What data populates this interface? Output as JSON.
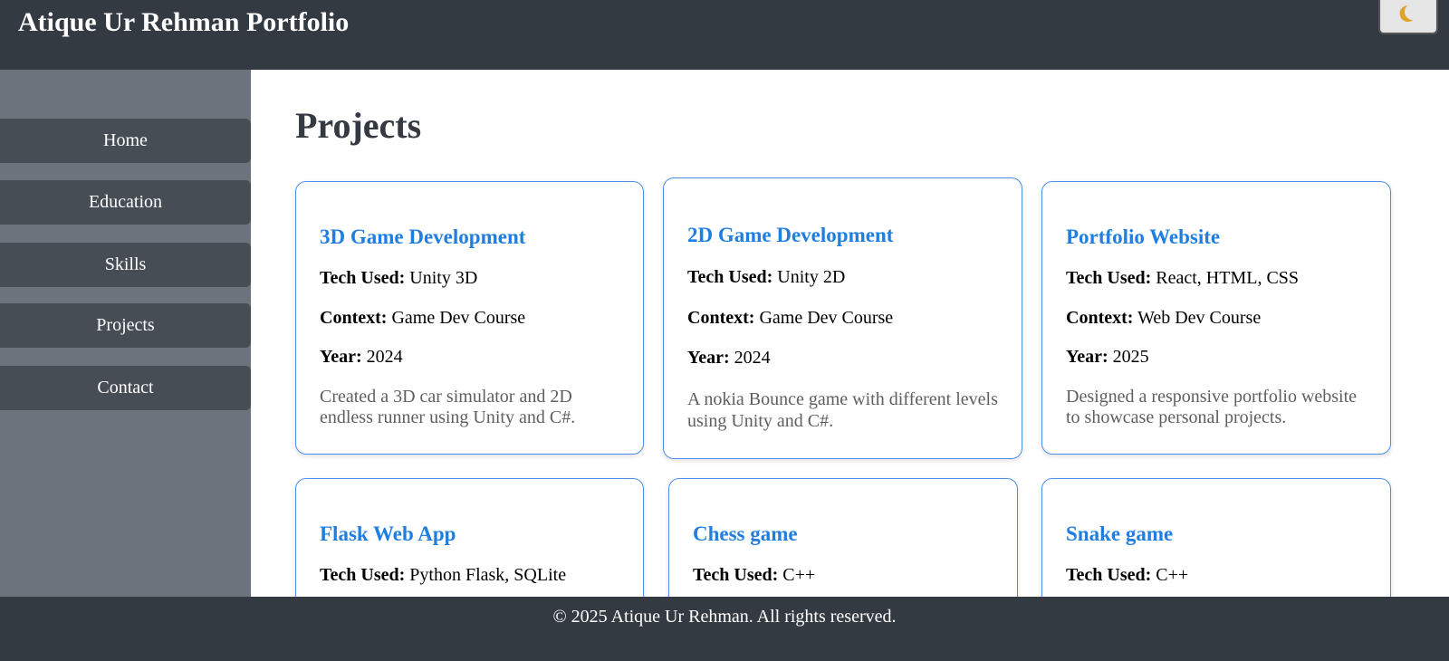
{
  "header": {
    "title": "Atique Ur Rehman Portfolio",
    "theme_toggle_icon": "moon-icon"
  },
  "sidebar": {
    "items": [
      {
        "label": "Home"
      },
      {
        "label": "Education"
      },
      {
        "label": "Skills"
      },
      {
        "label": "Projects"
      },
      {
        "label": "Contact"
      }
    ]
  },
  "main": {
    "title": "Projects",
    "projects": [
      {
        "name": "3D Game Development",
        "tech_label": "Tech Used:",
        "tech": "Unity 3D",
        "context_label": "Context:",
        "context": "Game Dev Course",
        "year_label": "Year:",
        "year": "2024",
        "description": "Created a 3D car simulator and 2D endless runner using Unity and C#."
      },
      {
        "name": "2D Game Development",
        "tech_label": "Tech Used:",
        "tech": "Unity 2D",
        "context_label": "Context:",
        "context": "Game Dev Course",
        "year_label": "Year:",
        "year": "2024",
        "description": "A nokia Bounce game with different levels using Unity and C#."
      },
      {
        "name": "Portfolio Website",
        "tech_label": "Tech Used:",
        "tech": "React, HTML, CSS",
        "context_label": "Context:",
        "context": "Web Dev Course",
        "year_label": "Year:",
        "year": "2025",
        "description": "Designed a responsive portfolio website to showcase personal projects."
      },
      {
        "name": "Flask Web App",
        "tech_label": "Tech Used:",
        "tech": "Python Flask, SQLite"
      },
      {
        "name": "Chess game",
        "tech_label": "Tech Used:",
        "tech": "C++"
      },
      {
        "name": "Snake game",
        "tech_label": "Tech Used:",
        "tech": "C++"
      }
    ]
  },
  "footer": {
    "text": "© 2025 Atique Ur Rehman. All rights reserved."
  },
  "colors": {
    "header_bg": "#343a42",
    "sidebar_bg": "#6b737d",
    "nav_item_bg": "#474d55",
    "accent": "#1f7ee0",
    "card_border": "#4a8fea"
  }
}
